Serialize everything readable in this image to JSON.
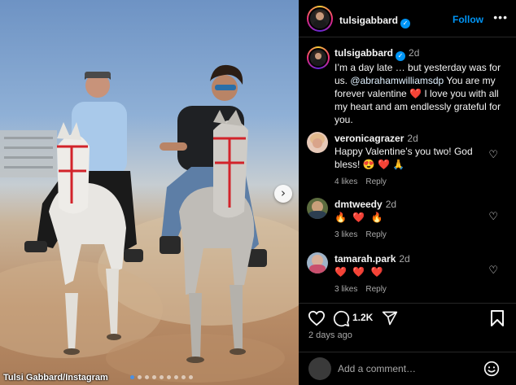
{
  "photo": {
    "credit": "Tulsi Gabbard/Instagram",
    "carousel_dots": 9,
    "active_dot": 0,
    "next_glyph": "›"
  },
  "post_header": {
    "username": "tulsigabbard",
    "follow_label": "Follow",
    "more_label": "•••"
  },
  "caption": {
    "username": "tulsigabbard",
    "time": "2d",
    "text_before": "I’m a day late … but yesterday was for us. ",
    "mention": "@abrahamwilliamsdp",
    "text_after": " You are my forever valentine ❤️ I love you with all my heart and am endlessly grateful for you."
  },
  "comments": [
    {
      "username": "veronicagrazer",
      "time": "2d",
      "text": "Happy Valentine’s you two! God bless! 😍 ❤️ 🙏",
      "likes": "4 likes",
      "reply": "Reply"
    },
    {
      "username": "dmtweedy",
      "time": "2d",
      "text": "🔥 ❤️ 🔥",
      "likes": "3 likes",
      "reply": "Reply"
    },
    {
      "username": "tamarah.park",
      "time": "2d",
      "text": "❤️ ❤️ ❤️",
      "likes": "3 likes",
      "reply": "Reply"
    }
  ],
  "actions": {
    "comment_count": "1.2K",
    "posted": "2 days ago"
  },
  "add_comment": {
    "placeholder": "Add a comment…"
  },
  "colors": {
    "accent": "#0095f6",
    "background": "#000000",
    "muted_text": "#a8a8a8",
    "heart": "#ed4956"
  }
}
